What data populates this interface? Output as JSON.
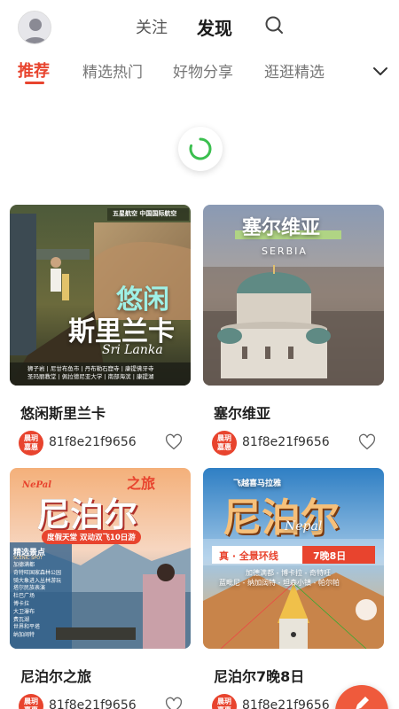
{
  "topnav": {
    "tabs": [
      {
        "label": "关注"
      },
      {
        "label": "发现"
      }
    ]
  },
  "categories": [
    "推荐",
    "精选热门",
    "好物分享",
    "逛逛精选"
  ],
  "cards": [
    {
      "title": "悠闲斯里兰卡",
      "author": "81f8e21f9656",
      "brand": "晨玥\n嘉惠",
      "image": {
        "badge": "五星航空 中国国际航空",
        "headline_1": "悠闲",
        "headline_2": "斯里兰卡",
        "script": "Sri Lanka",
        "footer": "狮子岩 | 尼甘布鱼市 | 丹布勒石窟寺 | 康提佛牙寺\n圣玛丽教堂 | 佩拉德尼亚大学 | 南部海滨 | 康提湖"
      }
    },
    {
      "title": "塞尔维亚",
      "author": "81f8e21f9656",
      "brand": "晨玥\n嘉惠",
      "image": {
        "headline": "塞尔维亚",
        "script": "SERBIA"
      }
    },
    {
      "title": "尼泊尔之旅",
      "author": "81f8e21f9656",
      "brand": "晨玥\n嘉惠",
      "image": {
        "script": "NePal",
        "headline": "尼泊尔",
        "suffix": "之旅",
        "banner": "度假天堂 双动双飞10日游",
        "spots_title": "精选景点",
        "spots_sub": "SCENIC SPOT",
        "spots": [
          "加德满都",
          "奇特旺国家森林公园",
          "骑大象进入丛林游玩",
          "塔尔民族表演",
          "杜巴广场",
          "博卡拉",
          "大卫瀑布",
          "费瓦湖",
          "世界和平塔",
          "纳加阔特"
        ]
      }
    },
    {
      "title": "尼泊尔7晚8日",
      "author": "81f8e21f9656",
      "brand": "晨玥\n嘉惠",
      "image": {
        "badge": "飞越喜马拉雅",
        "headline": "尼泊尔",
        "script": "Nepal",
        "banner_left": "真 · 全景环线",
        "banner_right": "7晚8日",
        "route_1": "加德满都 - 博卡拉 - 奇特旺",
        "route_2": "蓝毗尼 - 纳加阔特 - 坦森小镇 - 帕尔帕"
      }
    }
  ],
  "colors": {
    "accent": "#e8442e",
    "loader": "#3bbf4f"
  }
}
